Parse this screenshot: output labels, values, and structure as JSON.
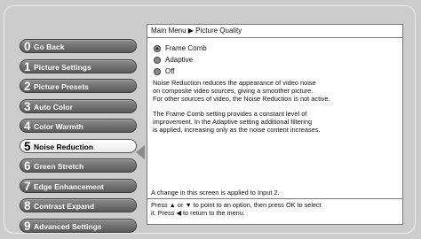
{
  "menu": {
    "items": [
      {
        "num": "0",
        "label": "Go Back"
      },
      {
        "num": "1",
        "label": "Picture Settings"
      },
      {
        "num": "2",
        "label": "Picture Presets"
      },
      {
        "num": "3",
        "label": "Auto Color"
      },
      {
        "num": "4",
        "label": "Color Warmth"
      },
      {
        "num": "5",
        "label": "Noise Reduction",
        "selected": true
      },
      {
        "num": "6",
        "label": "Green Stretch"
      },
      {
        "num": "7",
        "label": "Edge Enhancement"
      },
      {
        "num": "8",
        "label": "Contrast Expand"
      },
      {
        "num": "9",
        "label": "Advanced Settings"
      }
    ]
  },
  "panel": {
    "breadcrumb": "Main Menu ▶ Picture Quality",
    "options": [
      {
        "label": "Frame Comb",
        "selected": true
      },
      {
        "label": "Adaptive",
        "selected": false
      },
      {
        "label": "Off",
        "selected": false
      }
    ],
    "description": [
      "Noise Reduction reduces the appearance of video noise\non composite video sources, giving a smoother picture.\nFor other sources of video, the Noise Reduction is not active.",
      "The Frame Comb setting provides a constant level of\nimprovement. In the Adaptive setting additional filtering\nis applied, increasing only as the noise content increases."
    ],
    "notice": "A change in this screen is applied to Input 2.",
    "help": "Press ▲ or ▼ to point to an option, then press OK to select\nit. Press ◀ to return to the menu."
  }
}
